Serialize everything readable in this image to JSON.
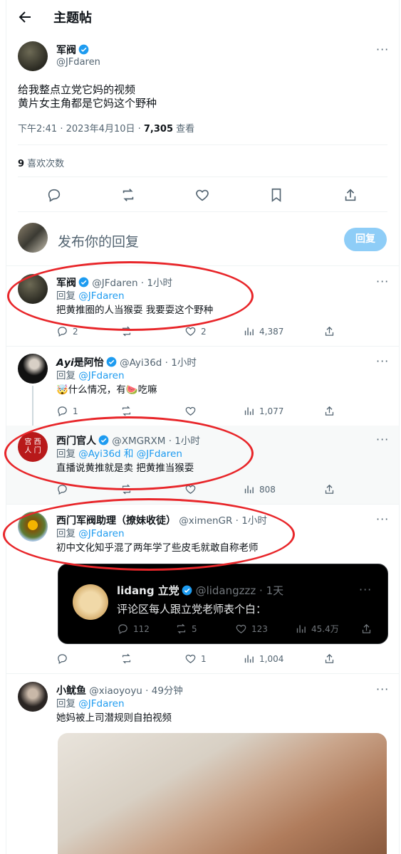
{
  "header": {
    "title": "主题帖"
  },
  "main_tweet": {
    "name": "军阀",
    "handle": "@JFdaren",
    "text_line1": "给我整点立党它妈的视频",
    "text_line2": "黄片女主角都是它妈这个野种",
    "time": "下午2:41 · 2023年4月10日 · ",
    "views": "7,305",
    "views_label": " 查看",
    "likes_count": "9",
    "likes_label": " 喜欢次数"
  },
  "composer": {
    "placeholder": "发布你的回复",
    "reply_button": "回复"
  },
  "replies": [
    {
      "name": "军阀",
      "handle": "@JFdaren",
      "time": " · 1小时",
      "reply_prefix": "回复 ",
      "reply_to": "@JFdaren",
      "text": "把黄推圈的人当猴耍 我要耍这个野种",
      "comments": "2",
      "retweets": "",
      "likes": "2",
      "views": "4,387"
    },
    {
      "name": "𝘼𝙮𝙞是阿怡",
      "handle": "@Ayi36d",
      "time": " · 1小时",
      "reply_prefix": "回复 ",
      "reply_to": "@JFdaren",
      "text": "🤯什么情况，有🍉吃嘛",
      "comments": "1",
      "retweets": "",
      "likes": "",
      "views": "1,077"
    },
    {
      "name": "西门官人",
      "handle": "@XMGRXM",
      "time": " · 1小时",
      "reply_prefix": "回复 ",
      "reply_to": "@Ayi36d 和 @JFdaren",
      "text": "直播说黄推就是卖 把黄推当猴耍",
      "comments": "",
      "retweets": "",
      "likes": "",
      "views": "808"
    },
    {
      "name": "西门军阀助理（撩妹收徒）",
      "handle": "@ximenGR",
      "time": " · 1小时",
      "reply_prefix": "回复 ",
      "reply_to": "@JFdaren",
      "text": "初中文化知乎混了两年学了些皮毛就敢自称老师",
      "comments": "",
      "retweets": "",
      "likes": "1",
      "views": "1,004"
    },
    {
      "name": "小鱿鱼",
      "handle": "@xiaoyoyu",
      "time": " · 49分钟",
      "reply_prefix": "回复 ",
      "reply_to": "@JFdaren",
      "text": "她妈被上司潜规则自拍视频"
    }
  ],
  "quote": {
    "name": "lidang 立党",
    "handle": "@lidangzzz",
    "time": " · 1天",
    "text": "评论区每人跟立党老师表个白：",
    "comments": "112",
    "retweets": "5",
    "likes": "123",
    "views": "45.4万"
  },
  "colors": {
    "accent": "#1d9bf0",
    "annotation_red": "#e8262a",
    "text": "#0f1419",
    "secondary": "#536471"
  }
}
